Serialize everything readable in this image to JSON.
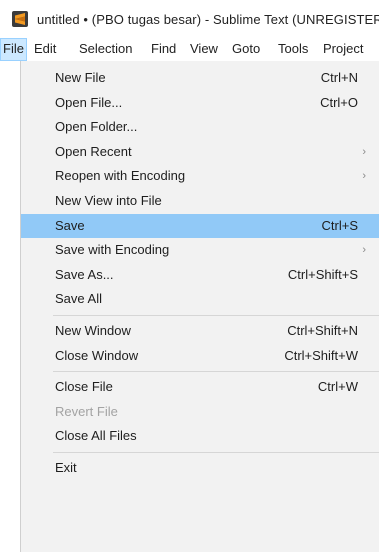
{
  "window": {
    "title": "untitled • (PBO tugas besar) - Sublime Text (UNREGISTERED)"
  },
  "colors": {
    "highlight": "#91c9f7",
    "menubar_active": "#cce8ff",
    "menu_background": "#f2f2f2",
    "app_icon": "#f39a21"
  },
  "menubar": {
    "items": [
      "File",
      "Edit",
      "Selection",
      "Find",
      "View",
      "Goto",
      "Tools",
      "Project"
    ]
  },
  "file_menu": {
    "groups": [
      [
        {
          "label": "New File",
          "shortcut": "Ctrl+N"
        },
        {
          "label": "Open File...",
          "shortcut": "Ctrl+O"
        },
        {
          "label": "Open Folder...",
          "shortcut": ""
        },
        {
          "label": "Open Recent",
          "shortcut": "",
          "submenu": true
        },
        {
          "label": "Reopen with Encoding",
          "shortcut": "",
          "submenu": true
        },
        {
          "label": "New View into File",
          "shortcut": ""
        },
        {
          "label": "Save",
          "shortcut": "Ctrl+S",
          "highlighted": true
        },
        {
          "label": "Save with Encoding",
          "shortcut": "",
          "submenu": true
        },
        {
          "label": "Save As...",
          "shortcut": "Ctrl+Shift+S"
        },
        {
          "label": "Save All",
          "shortcut": ""
        }
      ],
      [
        {
          "label": "New Window",
          "shortcut": "Ctrl+Shift+N"
        },
        {
          "label": "Close Window",
          "shortcut": "Ctrl+Shift+W"
        }
      ],
      [
        {
          "label": "Close File",
          "shortcut": "Ctrl+W"
        },
        {
          "label": "Revert File",
          "shortcut": "",
          "disabled": true
        },
        {
          "label": "Close All Files",
          "shortcut": ""
        }
      ],
      [
        {
          "label": "Exit",
          "shortcut": ""
        }
      ]
    ]
  }
}
